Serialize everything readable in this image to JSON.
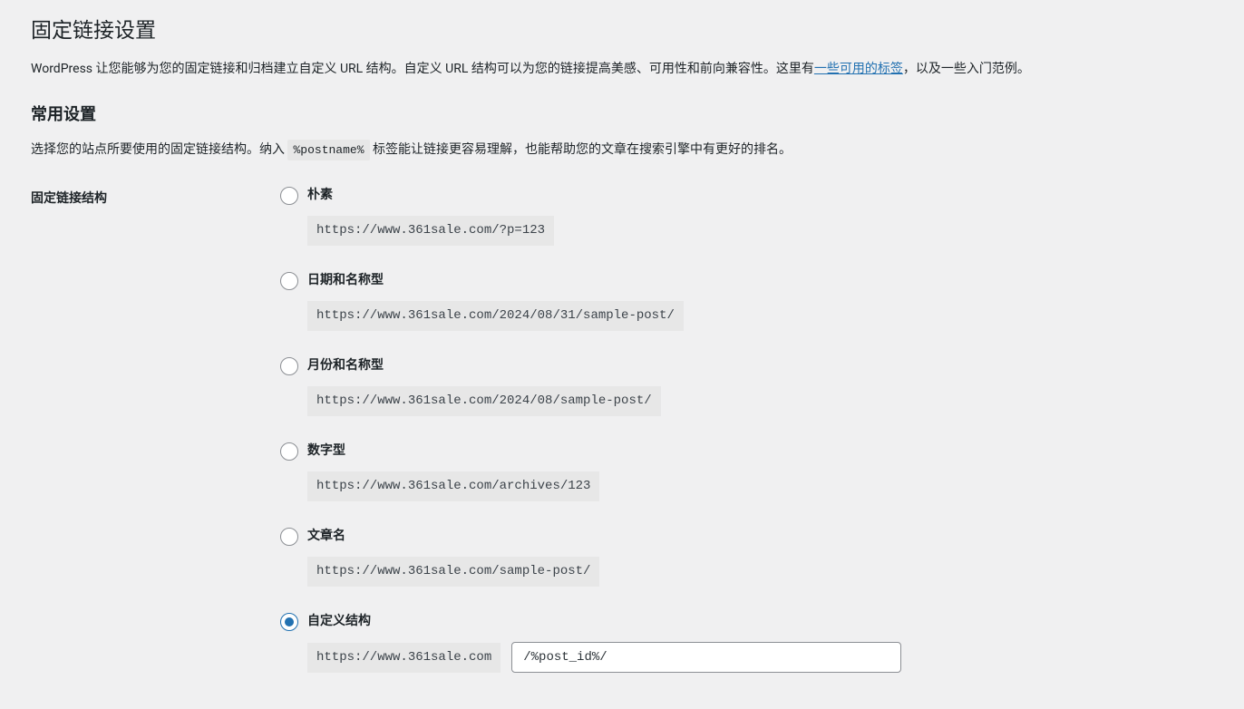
{
  "page": {
    "title": "固定链接设置",
    "intro_before_link": "WordPress 让您能够为您的固定链接和归档建立自定义 URL 结构。自定义 URL 结构可以为您的链接提高美感、可用性和前向兼容性。这里有",
    "intro_link_text": "一些可用的标签",
    "intro_after_link": "，以及一些入门范例。",
    "common_settings_heading": "常用设置",
    "common_settings_desc_before": "选择您的站点所要使用的固定链接结构。纳入 ",
    "common_settings_tag": "%postname%",
    "common_settings_desc_after": " 标签能让链接更容易理解，也能帮助您的文章在搜索引擎中有更好的排名。",
    "structure_label": "固定链接结构"
  },
  "options": {
    "plain": {
      "label": "朴素",
      "example": "https://www.361sale.com/?p=123"
    },
    "day_name": {
      "label": "日期和名称型",
      "example": "https://www.361sale.com/2024/08/31/sample-post/"
    },
    "month_name": {
      "label": "月份和名称型",
      "example": "https://www.361sale.com/2024/08/sample-post/"
    },
    "numeric": {
      "label": "数字型",
      "example": "https://www.361sale.com/archives/123"
    },
    "post_name": {
      "label": "文章名",
      "example": "https://www.361sale.com/sample-post/"
    },
    "custom": {
      "label": "自定义结构",
      "base": "https://www.361sale.com",
      "value": "/%post_id%/"
    }
  },
  "selected": "custom"
}
